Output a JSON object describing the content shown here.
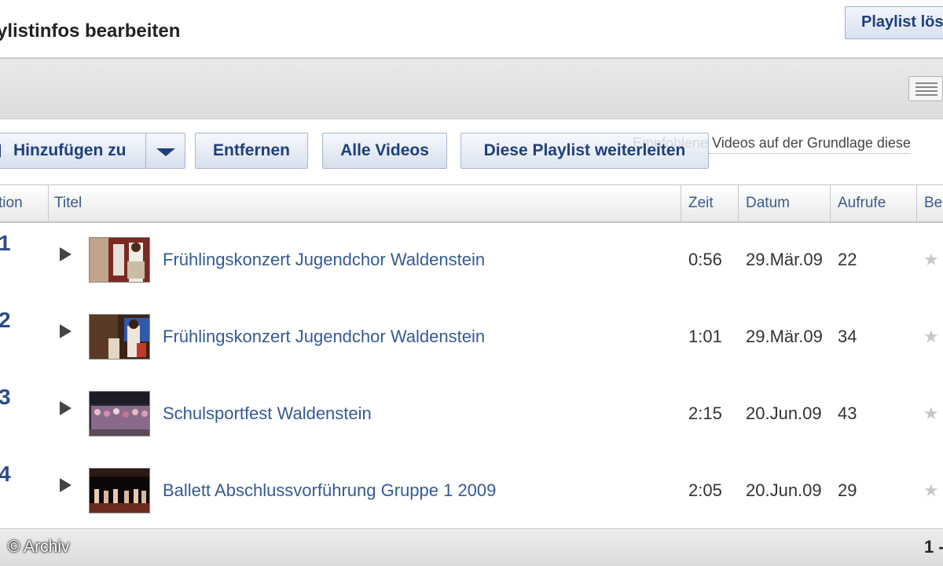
{
  "page_title": "ylistinfos bearbeiten",
  "delete_button": "Playlist lös",
  "toolbar": {
    "add_to": "Hinzufügen zu",
    "remove": "Entfernen",
    "all_videos": "Alle Videos",
    "share": "Diese Playlist weiterleiten",
    "recommended": "Empfohlene Videos auf der Grundlage diese"
  },
  "columns": {
    "position": "tion",
    "title": "Titel",
    "time": "Zeit",
    "date": "Datum",
    "views": "Aufrufe",
    "rating": "Be"
  },
  "rows": [
    {
      "position": "1",
      "title": "Frühlingskonzert Jugendchor Waldenstein",
      "time": "0:56",
      "date": "29.Mär.09",
      "views": "22"
    },
    {
      "position": "2",
      "title": "Frühlingskonzert Jugendchor Waldenstein",
      "time": "1:01",
      "date": "29.Mär.09",
      "views": "34"
    },
    {
      "position": "3",
      "title": "Schulsportfest Waldenstein",
      "time": "2:15",
      "date": "20.Jun.09",
      "views": "43"
    },
    {
      "position": "4",
      "title": "Ballett Abschlussvorführung Gruppe 1 2009",
      "time": "2:05",
      "date": "20.Jun.09",
      "views": "29"
    }
  ],
  "star_glyph": "★",
  "pager": "1 -",
  "copyright": "© Archiv"
}
